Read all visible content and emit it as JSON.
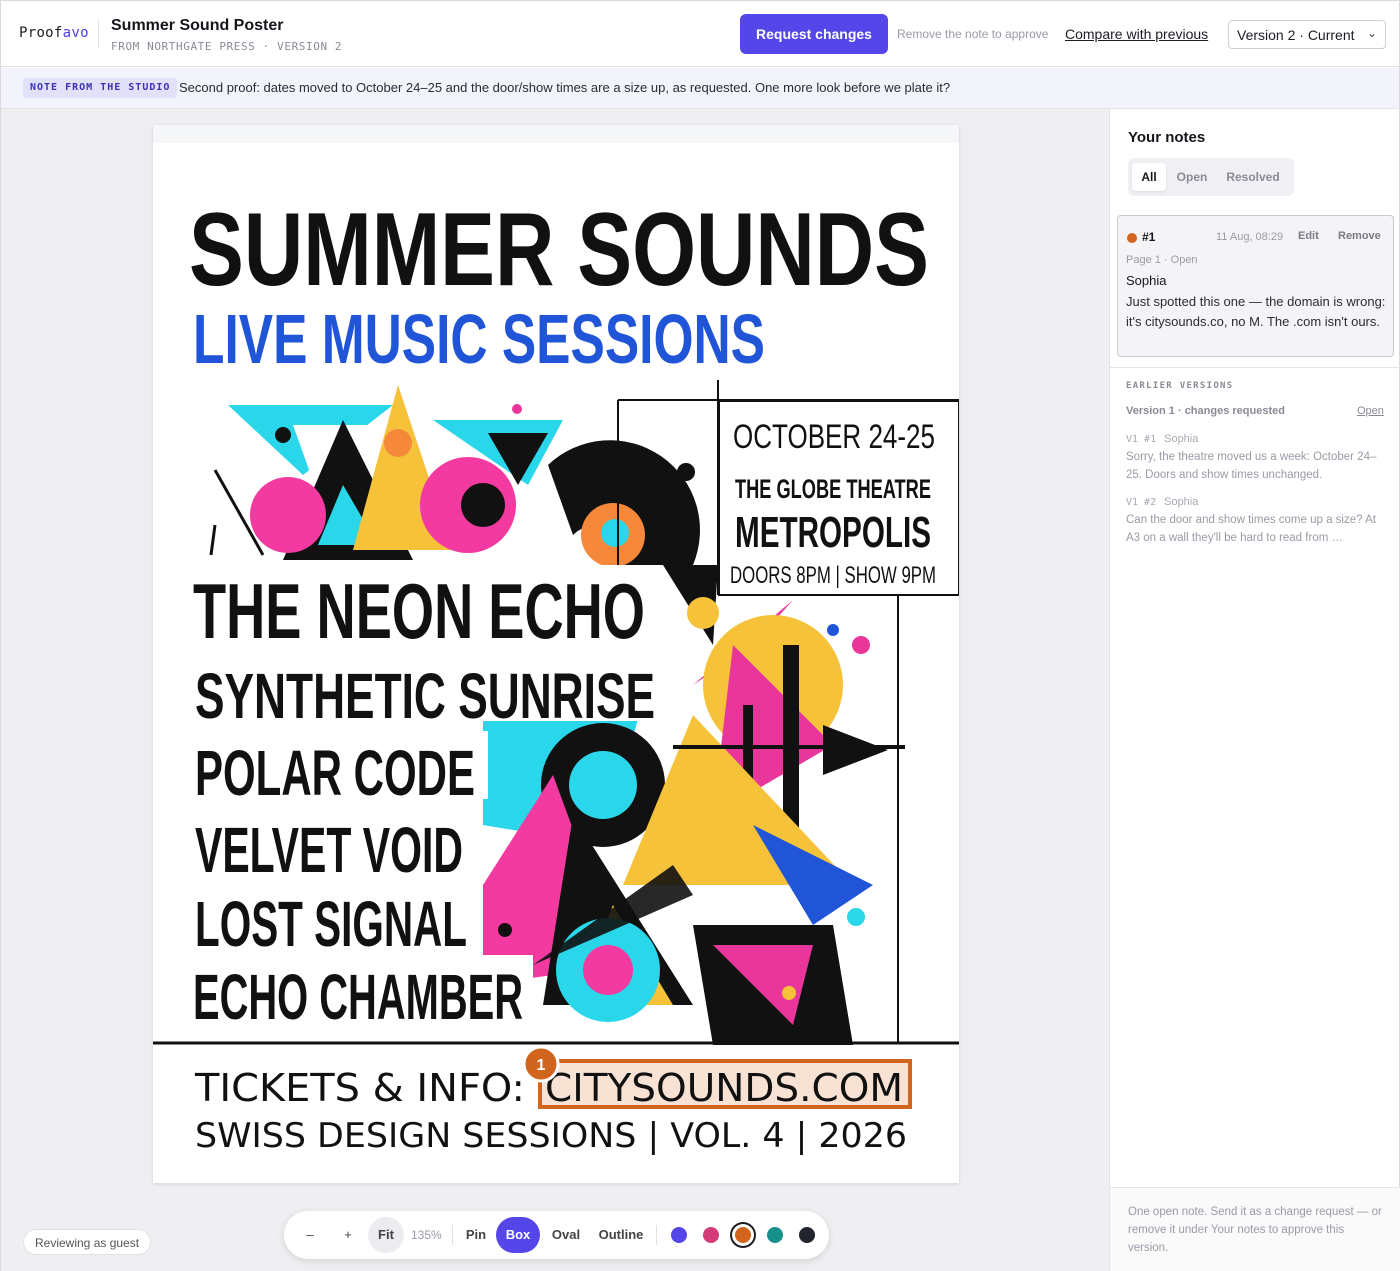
{
  "header": {
    "brand_prefix": "Proof",
    "brand_suffix": "avo",
    "title": "Summer Sound Poster",
    "subtitle": "FROM NORTHGATE PRESS · VERSION 2",
    "request_button": "Request changes",
    "approve_hint": "Remove the note to approve",
    "compare_link": "Compare with previous",
    "version_select": "Version 2 · Current"
  },
  "banner": {
    "tag": "NOTE FROM THE STUDIO",
    "text": "Second proof: dates moved to October 24–25 and the door/show times are a size up, as requested. One more look before we plate it?"
  },
  "poster": {
    "title": "SUMMER SOUNDS",
    "subtitle": "LIVE MUSIC SESSIONS",
    "date": "OCTOBER 24-25",
    "venue_line1": "THE GLOBE THEATRE",
    "venue_line2": "METROPOLIS",
    "times": "DOORS 8PM | SHOW 9PM",
    "bands": [
      "THE NEON ECHO",
      "SYNTHETIC SUNRISE",
      "POLAR CODE",
      "VELVET VOID",
      "LOST SIGNAL",
      "ECHO CHAMBER"
    ],
    "tickets_label": "TICKETS & INFO:",
    "tickets_url": "CITYSOUNDS.COM",
    "footer": "SWISS DESIGN SESSIONS | VOL. 4 | 2026",
    "pin_number": "1"
  },
  "toolbar": {
    "zoom_out": "–",
    "zoom_in": "+",
    "fit": "Fit",
    "zoom": "135%",
    "tools": [
      "Pin",
      "Box",
      "Oval",
      "Outline"
    ],
    "active_tool": "Box",
    "colors": [
      "#5446e8",
      "#d23c78",
      "#d2651e",
      "#17908c",
      "#23252e"
    ],
    "active_color": "#d2651e"
  },
  "guest_label": "Reviewing as guest",
  "notes": {
    "heading": "Your notes",
    "tabs": [
      "All",
      "Open",
      "Resolved"
    ],
    "active_tab": "All",
    "current": {
      "number": "#1",
      "date": "11 Aug, 08:29",
      "edit": "Edit",
      "remove": "Remove",
      "meta": "Page 1 · Open",
      "author": "Sophia",
      "body": "Just spotted this one — the domain is wrong: it's citysounds.co, no M. The .com isn't ours."
    },
    "earlier_label": "EARLIER VERSIONS",
    "earlier": {
      "version": "Version 1 · changes requested",
      "open_link": "Open",
      "items": [
        {
          "ref": "V1 #1",
          "author": "Sophia",
          "text": "Sorry, the theatre moved us a week: October 24–25. Doors and show times unchanged."
        },
        {
          "ref": "V1 #2",
          "author": "Sophia",
          "text": "Can the door and show times come up a size? At A3 on a wall they'll be hard to read from …"
        }
      ]
    },
    "footer": "One open note. Send it as a change request — or remove it under Your notes to approve this version."
  }
}
